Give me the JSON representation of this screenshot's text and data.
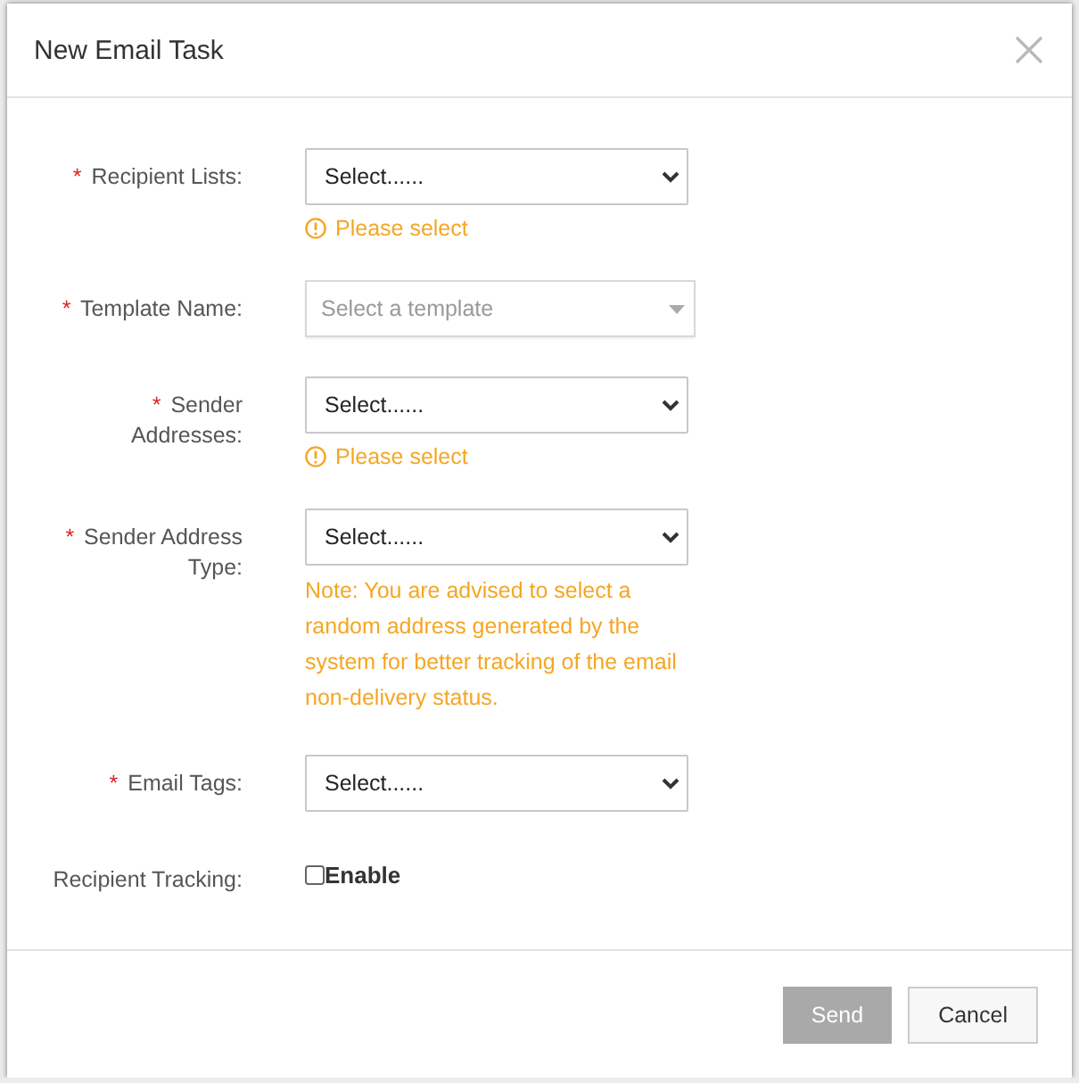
{
  "dialog": {
    "title": "New Email Task"
  },
  "fields": [
    {
      "label": "Recipient Lists:",
      "required_mark": "*",
      "control": {
        "kind": "select",
        "value": "Select......"
      },
      "message": {
        "kind": "error",
        "text": "Please select"
      }
    },
    {
      "label": "Template Name:",
      "required_mark": "*",
      "control": {
        "kind": "combobox",
        "placeholder": "Select a template"
      }
    },
    {
      "label": "Sender Addresses:",
      "required_mark": "*",
      "control": {
        "kind": "select",
        "value": "Select......"
      },
      "message": {
        "kind": "error",
        "text": "Please select"
      }
    },
    {
      "label": "Sender Address Type:",
      "required_mark": "*",
      "control": {
        "kind": "select",
        "value": "Select......"
      },
      "message": {
        "kind": "note",
        "text": "Note: You are advised to select a random address generated by the system for better tracking of the email non-delivery status."
      }
    },
    {
      "label": "Email Tags:",
      "required_mark": "*",
      "control": {
        "kind": "select",
        "value": "Select......"
      }
    },
    {
      "label": "Recipient Tracking:",
      "control": {
        "kind": "checkbox",
        "label": "Enable",
        "checked": false
      }
    }
  ],
  "buttons": [
    {
      "label": "Send",
      "disabled": true
    },
    {
      "label": "Cancel",
      "disabled": false
    }
  ]
}
